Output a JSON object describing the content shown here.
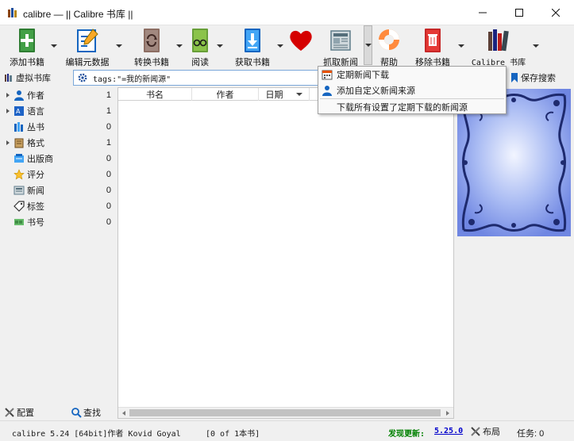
{
  "window": {
    "title": "calibre — || Calibre 书库 ||"
  },
  "toolbar": {
    "buttons": [
      {
        "label": "添加书籍",
        "icon": "add-book-icon"
      },
      {
        "label": "编辑元数据",
        "icon": "edit-metadata-icon"
      },
      {
        "label": "转换书籍",
        "icon": "convert-book-icon"
      },
      {
        "label": "阅读",
        "icon": "read-book-icon"
      },
      {
        "label": "获取书籍",
        "icon": "get-books-icon"
      },
      {
        "label": "",
        "icon": "donate-heart-icon"
      },
      {
        "label": "抓取新闻",
        "icon": "fetch-news-icon"
      },
      {
        "label": "帮助",
        "icon": "help-lifebuoy-icon"
      },
      {
        "label": "移除书籍",
        "icon": "remove-book-icon"
      },
      {
        "label": "Calibre 书库",
        "icon": "library-icon"
      }
    ]
  },
  "searchbar": {
    "virtual_library": "虚拟书库",
    "query": "tags:\"=我的新闻源\"",
    "save_search": "保存搜索"
  },
  "tag_browser": {
    "items": [
      {
        "label": "作者",
        "count": "1",
        "expandable": true,
        "icon": "person-icon"
      },
      {
        "label": "语言",
        "count": "1",
        "expandable": true,
        "icon": "language-icon"
      },
      {
        "label": "丛书",
        "count": "0",
        "expandable": false,
        "icon": "series-icon"
      },
      {
        "label": "格式",
        "count": "1",
        "expandable": true,
        "icon": "format-icon"
      },
      {
        "label": "出版商",
        "count": "0",
        "expandable": false,
        "icon": "publisher-icon"
      },
      {
        "label": "评分",
        "count": "0",
        "expandable": false,
        "icon": "rating-star-icon"
      },
      {
        "label": "新闻",
        "count": "0",
        "expandable": false,
        "icon": "news-icon"
      },
      {
        "label": "标签",
        "count": "0",
        "expandable": false,
        "icon": "tag-icon"
      },
      {
        "label": "书号",
        "count": "0",
        "expandable": false,
        "icon": "identifier-icon"
      }
    ],
    "configure": "配置",
    "find": "查找"
  },
  "book_list": {
    "columns": [
      "书名",
      "作者",
      "日期"
    ]
  },
  "news_menu": {
    "items": [
      {
        "label": "定期新闻下载",
        "icon": "calendar-icon"
      },
      {
        "label": "添加自定义新闻来源",
        "icon": "user-add-icon"
      },
      {
        "label": "下载所有设置了定期下载的新闻源",
        "icon": ""
      }
    ]
  },
  "statusbar": {
    "version": "calibre 5.24 [64bit]作者 Kovid Goyal",
    "count": "[0 of 1本书]",
    "update_label": "发现更新:",
    "update_version": "5.25.0",
    "layout": "布局",
    "jobs": "任务: 0"
  },
  "colors": {
    "accent": "#1565c0",
    "update_green": "#008000",
    "link_blue": "#0000cc"
  }
}
